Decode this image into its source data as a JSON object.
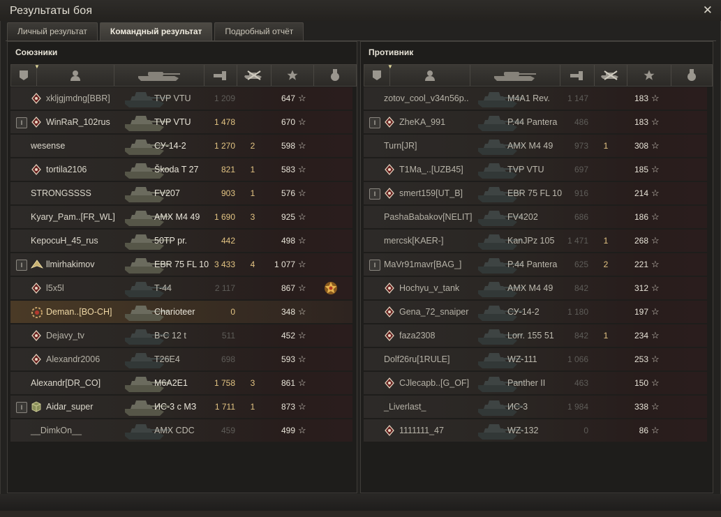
{
  "window": {
    "title": "Результаты боя",
    "close_icon": "close-icon"
  },
  "tabs": [
    {
      "label": "Личный результат",
      "active": false
    },
    {
      "label": "Командный результат",
      "active": true
    },
    {
      "label": "Подробный отчёт",
      "active": false
    }
  ],
  "colors": {
    "gold": "#e3c483",
    "dim": "#8f8b83",
    "gray": "#5e5c58",
    "accent": "#e0d79a"
  },
  "allies": {
    "title": "Союзники",
    "columns": [
      "platoon-icon",
      "player-icon",
      "tank-icon",
      "damage-icon",
      "kills-icon",
      "xp-star-icon",
      "medal-icon"
    ],
    "rows": [
      {
        "name": "xkljgjmdng[BBR]",
        "vehicle": "TVP VTU",
        "damage": "1 209",
        "damage_style": "gray",
        "kills": "",
        "xp": "647",
        "platoon": "",
        "badge": "diamond",
        "medal": false,
        "dead": true
      },
      {
        "name": "WinRaR_102rus",
        "vehicle": "TVP VTU",
        "damage": "1 478",
        "damage_style": "gold",
        "kills": "",
        "xp": "670",
        "platoon": "I",
        "badge": "diamond",
        "medal": false,
        "dead": false
      },
      {
        "name": "wesense",
        "vehicle": "СУ-14-2",
        "damage": "1 270",
        "damage_style": "gold",
        "kills": "2",
        "xp": "598",
        "platoon": "",
        "badge": "",
        "medal": false,
        "dead": false
      },
      {
        "name": "tortila2106",
        "vehicle": "Škoda T 27",
        "damage": "821",
        "damage_style": "gold",
        "kills": "1",
        "xp": "583",
        "platoon": "",
        "badge": "diamond",
        "medal": false,
        "dead": false
      },
      {
        "name": "STRONGSSSS",
        "vehicle": "FV207",
        "damage": "903",
        "damage_style": "gold",
        "kills": "1",
        "xp": "576",
        "platoon": "",
        "badge": "",
        "medal": false,
        "dead": false
      },
      {
        "name": "Kyary_Pam..[FR_WL]",
        "vehicle": "AMX M4 49",
        "damage": "1 690",
        "damage_style": "gold",
        "kills": "3",
        "xp": "925",
        "platoon": "",
        "badge": "",
        "medal": false,
        "dead": false
      },
      {
        "name": "KepocuH_45_rus",
        "vehicle": "50TP pr.",
        "damage": "442",
        "damage_style": "gold",
        "kills": "",
        "xp": "498",
        "platoon": "",
        "badge": "",
        "medal": false,
        "dead": false
      },
      {
        "name": "llmirhakimov",
        "vehicle": "EBR 75 FL 10",
        "damage": "3 433",
        "damage_style": "gold",
        "kills": "4",
        "xp": "1 077",
        "platoon": "I",
        "badge": "wings",
        "medal": false,
        "dead": false
      },
      {
        "name": "l5x5l",
        "vehicle": "T-44",
        "damage": "2 117",
        "damage_style": "gray",
        "kills": "",
        "xp": "867",
        "platoon": "",
        "badge": "diamond",
        "medal": true,
        "dead": true
      },
      {
        "name": "Deman..[BO-CH]",
        "vehicle": "Charioteer",
        "damage": "0",
        "damage_style": "gold",
        "kills": "",
        "xp": "348",
        "platoon": "",
        "badge": "gear",
        "medal": false,
        "dead": false,
        "self": true
      },
      {
        "name": "Dejavy_tv",
        "vehicle": "B-C 12 t",
        "damage": "511",
        "damage_style": "gray",
        "kills": "",
        "xp": "452",
        "platoon": "",
        "badge": "diamond",
        "medal": false,
        "dead": true
      },
      {
        "name": "Alexandr2006",
        "vehicle": "T26E4",
        "damage": "698",
        "damage_style": "gray",
        "kills": "",
        "xp": "593",
        "platoon": "",
        "badge": "diamond",
        "medal": false,
        "dead": true
      },
      {
        "name": "Alexandr[DR_CO]",
        "vehicle": "M6A2E1",
        "damage": "1 758",
        "damage_style": "gold",
        "kills": "3",
        "xp": "861",
        "platoon": "",
        "badge": "",
        "medal": false,
        "dead": false
      },
      {
        "name": "Aidar_super",
        "vehicle": "ИС-3 с МЗ",
        "damage": "1 711",
        "damage_style": "gold",
        "kills": "1",
        "xp": "873",
        "platoon": "I",
        "badge": "cube",
        "medal": false,
        "dead": false
      },
      {
        "name": "__DimkOn__",
        "vehicle": "AMX CDC",
        "damage": "459",
        "damage_style": "gray",
        "kills": "",
        "xp": "499",
        "platoon": "",
        "badge": "",
        "medal": false,
        "dead": true
      }
    ]
  },
  "enemies": {
    "title": "Противник",
    "columns": [
      "platoon-icon",
      "player-icon",
      "tank-icon",
      "damage-icon",
      "kills-icon",
      "xp-star-icon",
      "medal-icon"
    ],
    "rows": [
      {
        "name": "zotov_cool_v34n56p..",
        "vehicle": "M4A1 Rev.",
        "damage": "1 147",
        "damage_style": "gray",
        "kills": "",
        "xp": "183",
        "platoon": "",
        "badge": "",
        "dead": true
      },
      {
        "name": "ZheKA_991",
        "vehicle": "P.44 Pantera",
        "damage": "486",
        "damage_style": "gray",
        "kills": "",
        "xp": "183",
        "platoon": "I",
        "badge": "diamond",
        "dead": true
      },
      {
        "name": "Turn[JR]",
        "vehicle": "AMX M4 49",
        "damage": "973",
        "damage_style": "gray",
        "kills": "1",
        "xp": "308",
        "platoon": "",
        "badge": "",
        "dead": true
      },
      {
        "name": "T1Ma_..[UZB45]",
        "vehicle": "TVP VTU",
        "damage": "697",
        "damage_style": "gray",
        "kills": "",
        "xp": "185",
        "platoon": "",
        "badge": "diamond",
        "dead": true
      },
      {
        "name": "smert159[UT_B]",
        "vehicle": "EBR 75 FL 10",
        "damage": "916",
        "damage_style": "gray",
        "kills": "",
        "xp": "214",
        "platoon": "I",
        "badge": "diamond",
        "dead": true
      },
      {
        "name": "PashaBabakov[NELIT]",
        "vehicle": "FV4202",
        "damage": "686",
        "damage_style": "gray",
        "kills": "",
        "xp": "186",
        "platoon": "",
        "badge": "",
        "dead": true
      },
      {
        "name": "mercsk[KAER-]",
        "vehicle": "KanJPz 105",
        "damage": "1 471",
        "damage_style": "gray",
        "kills": "1",
        "xp": "268",
        "platoon": "",
        "badge": "",
        "dead": true
      },
      {
        "name": "MaVr91mavr[BAG_]",
        "vehicle": "P.44 Pantera",
        "damage": "625",
        "damage_style": "gray",
        "kills": "2",
        "xp": "221",
        "platoon": "I",
        "badge": "",
        "dead": true
      },
      {
        "name": "Hochyu_v_tank",
        "vehicle": "AMX M4 49",
        "damage": "842",
        "damage_style": "gray",
        "kills": "",
        "xp": "312",
        "platoon": "",
        "badge": "diamond",
        "dead": true
      },
      {
        "name": "Gena_72_snaiper",
        "vehicle": "СУ-14-2",
        "damage": "1 180",
        "damage_style": "gray",
        "kills": "",
        "xp": "197",
        "platoon": "",
        "badge": "diamond",
        "dead": true
      },
      {
        "name": "faza2308",
        "vehicle": "Lorr. 155 51",
        "damage": "842",
        "damage_style": "gray",
        "kills": "1",
        "xp": "234",
        "platoon": "",
        "badge": "diamond",
        "dead": true
      },
      {
        "name": "Dolf26ru[1RULE]",
        "vehicle": "WZ-111",
        "damage": "1 066",
        "damage_style": "gray",
        "kills": "",
        "xp": "253",
        "platoon": "",
        "badge": "",
        "dead": true
      },
      {
        "name": "CJlecapb..[G_OF]",
        "vehicle": "Panther II",
        "damage": "463",
        "damage_style": "gray",
        "kills": "",
        "xp": "150",
        "platoon": "",
        "badge": "diamond",
        "dead": true
      },
      {
        "name": "_Liverlast_",
        "vehicle": "ИС-3",
        "damage": "1 984",
        "damage_style": "gray",
        "kills": "",
        "xp": "338",
        "platoon": "",
        "badge": "",
        "dead": true
      },
      {
        "name": "1111111_47",
        "vehicle": "WZ-132",
        "damage": "0",
        "damage_style": "gray",
        "kills": "",
        "xp": "86",
        "platoon": "",
        "badge": "diamond",
        "dead": true
      }
    ]
  }
}
